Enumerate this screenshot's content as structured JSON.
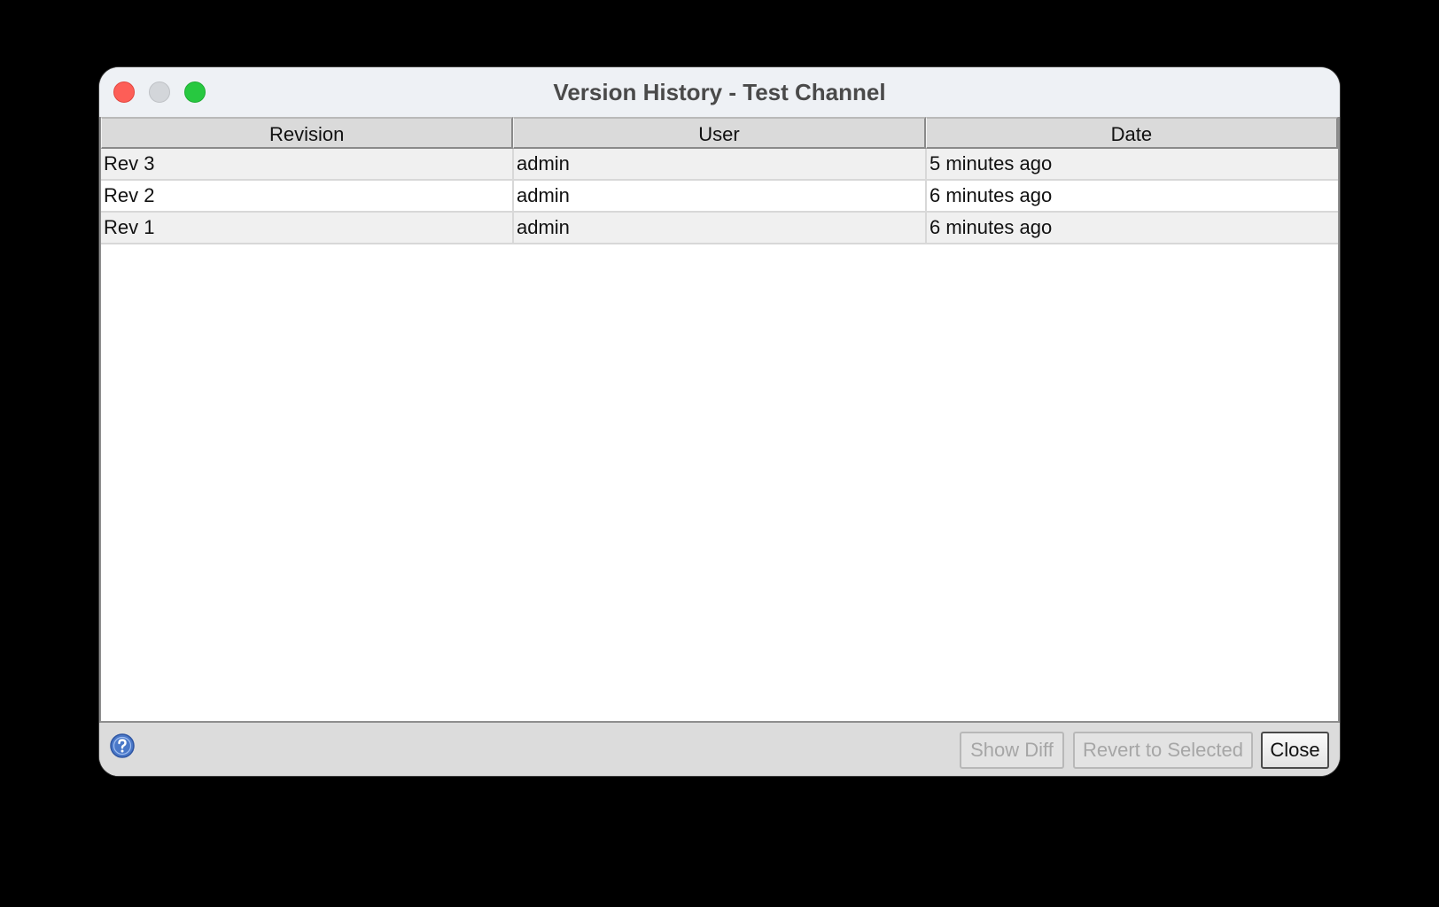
{
  "window": {
    "title": "Version History - Test Channel"
  },
  "table": {
    "columns": [
      "Revision",
      "User",
      "Date"
    ],
    "rows": [
      {
        "revision": "Rev 3",
        "user": "admin",
        "date": "5 minutes ago"
      },
      {
        "revision": "Rev 2",
        "user": "admin",
        "date": "6 minutes ago"
      },
      {
        "revision": "Rev 1",
        "user": "admin",
        "date": "6 minutes ago"
      }
    ]
  },
  "footer": {
    "help_icon": "help-icon",
    "show_diff_label": "Show Diff",
    "revert_label": "Revert to Selected",
    "close_label": "Close"
  },
  "colors": {
    "close_button": "#fd5e57",
    "minimize_button": "#d3d6da",
    "maximize_button": "#27c840",
    "help_icon": "#4a78c8"
  }
}
